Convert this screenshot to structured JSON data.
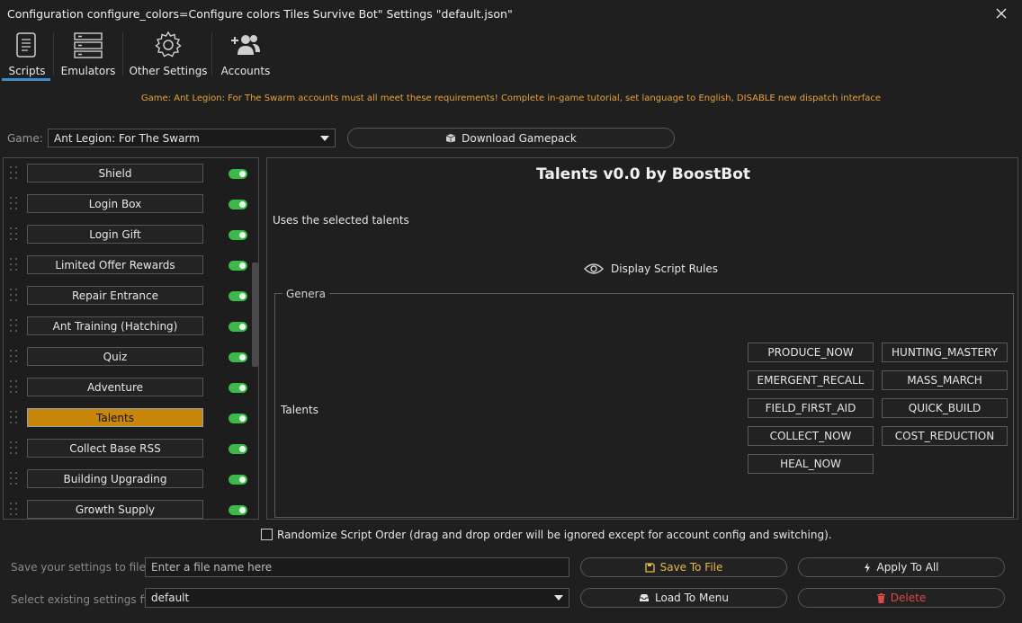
{
  "window": {
    "title": "Configuration configure_colors=Configure colors Tiles Survive Bot\" Settings \"default.json\""
  },
  "tabs": [
    {
      "label": "Scripts",
      "icon": "scroll-icon",
      "active": true
    },
    {
      "label": "Emulators",
      "icon": "server-icon"
    },
    {
      "label": "Other Settings",
      "icon": "gear-icon"
    },
    {
      "label": "Accounts",
      "icon": "users-add-icon"
    }
  ],
  "notice": "Game: Ant Legion: For The Swarm accounts must all meet these requirements! Complete in-game tutorial, set language to English, DISABLE new dispatch interface",
  "game": {
    "label": "Game:",
    "selected": "Ant Legion: For The Swarm",
    "download_label": "Download Gamepack"
  },
  "scripts": [
    {
      "label": "Shield",
      "enabled": true
    },
    {
      "label": "Login Box",
      "enabled": true
    },
    {
      "label": "Login Gift",
      "enabled": true
    },
    {
      "label": "Limited Offer Rewards",
      "enabled": true
    },
    {
      "label": "Repair Entrance",
      "enabled": true
    },
    {
      "label": "Ant Training (Hatching)",
      "enabled": true
    },
    {
      "label": "Quiz",
      "enabled": true
    },
    {
      "label": "Adventure",
      "enabled": true
    },
    {
      "label": "Talents",
      "enabled": true,
      "active": true
    },
    {
      "label": "Collect Base RSS",
      "enabled": true
    },
    {
      "label": "Building Upgrading",
      "enabled": true
    },
    {
      "label": "Growth Supply",
      "enabled": true
    }
  ],
  "main": {
    "title": "Talents v0.0 by BoostBot",
    "description": "Uses the selected talents",
    "rules_label": "Display Script Rules",
    "group_title": "Genera",
    "talents_label": "Talents",
    "talent_buttons": [
      "PRODUCE_NOW",
      "HUNTING_MASTERY",
      "EMERGENT_RECALL",
      "MASS_MARCH",
      "FIELD_FIRST_AID",
      "QUICK_BUILD",
      "COLLECT_NOW",
      "COST_REDUCTION",
      "HEAL_NOW"
    ]
  },
  "randomize_label": "Randomize Script Order (drag and drop order will be ignored except for account config and switching).",
  "bottom": {
    "save_label": "Save your settings to file",
    "file_placeholder": "Enter a file name here",
    "save_button": "Save To File",
    "apply_button": "Apply To All",
    "select_label": "Select existing settings file",
    "selected_file": "default",
    "load_button": "Load To Menu",
    "delete_button": "Delete"
  },
  "colors": {
    "accent": "#3a8fd0",
    "active_script": "#c8860a",
    "toggle_on": "#3db84a",
    "notice": "#e8a23a",
    "delete": "#e04848"
  }
}
